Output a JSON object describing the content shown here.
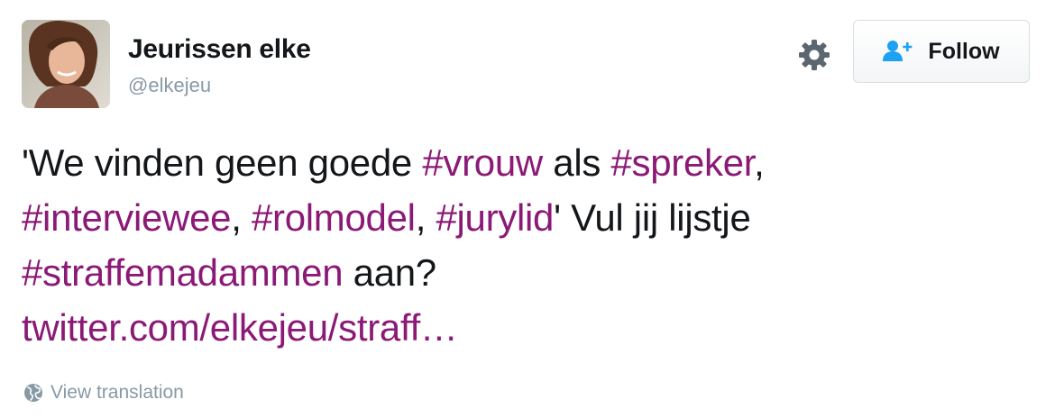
{
  "user": {
    "display_name": "Jeurissen elke",
    "handle": "@elkejeu"
  },
  "header": {
    "follow_label": "Follow"
  },
  "tweet": {
    "t1": "'We vinden geen goede ",
    "h_vrouw": "#vrouw",
    "t2": " als ",
    "h_spreker": "#spreker",
    "t3": ", ",
    "h_interviewee": "#interviewee",
    "t4": ", ",
    "h_rolmodel": "#rolmodel",
    "t5": ", ",
    "h_jurylid": "#jurylid",
    "t6": "' Vul jij lijstje ",
    "h_straffemadammen": "#straffemadammen",
    "t7": " aan?",
    "link": "twitter.com/elkejeu/straff…"
  },
  "footer": {
    "view_translation": "View translation"
  },
  "colors": {
    "hashtag": "#8b1a76",
    "text": "#14171a",
    "muted": "#8899a6",
    "follow_icon": "#1da1f2"
  },
  "icons": {
    "settings": "gear-icon",
    "follow": "follow-user-icon",
    "translation": "globe-icon"
  }
}
